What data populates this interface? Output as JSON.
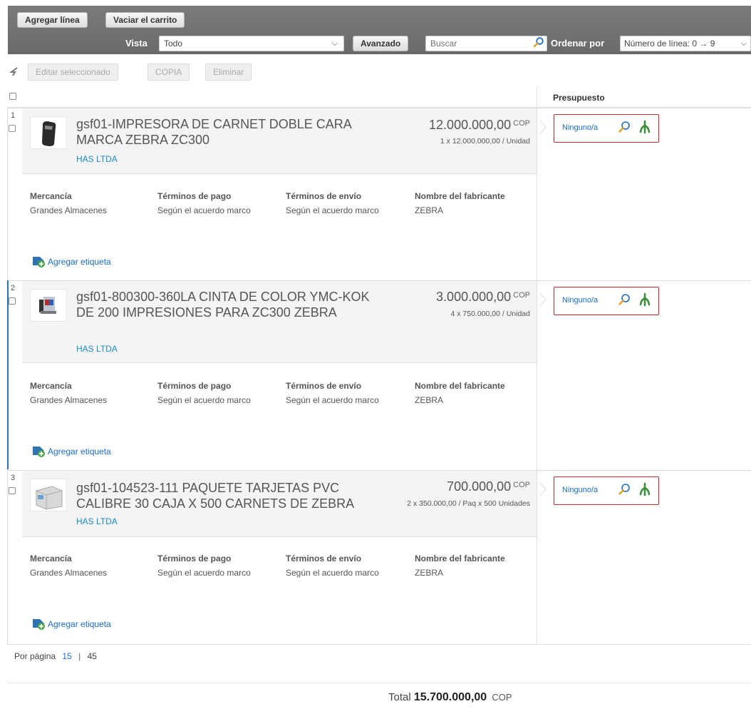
{
  "toolbar": {
    "add_line": "Agregar línea",
    "empty_cart": "Vaciar el carrito",
    "view_label": "Vista",
    "view_value": "Todo",
    "advanced": "Avanzado",
    "search_placeholder": "Buscar",
    "sort_label": "Ordenar por",
    "sort_value": "Número de línea: 0 → 9"
  },
  "actions": {
    "edit_selected": "Editar seleccionado",
    "copy": "COPIA",
    "delete": "Eliminar"
  },
  "grid": {
    "budget_header": "Presupuesto"
  },
  "attr_labels": {
    "commodity": "Mercancía",
    "payment_terms": "Términos de pago",
    "shipping_terms": "Términos de envío",
    "manufacturer": "Nombre del fabricante"
  },
  "items": [
    {
      "number": "1",
      "title": "gsf01-IMPRESORA DE CARNET DOBLE CARA MARCA ZEBRA ZC300",
      "supplier": "HAS LTDA",
      "price": "12.000.000,00",
      "currency": "COP",
      "unit_info": "1 x 12.000.000,00 / Unidad",
      "budget": "Ninguno/a",
      "commodity": "Grandes Almacenes",
      "payment_terms": "Según el acuerdo marco",
      "shipping_terms": "Según el acuerdo marco",
      "manufacturer": "ZEBRA",
      "add_tag": "Agregar etiqueta"
    },
    {
      "number": "2",
      "title": "gsf01-800300-360LA CINTA DE COLOR YMC-KOK DE 200 IMPRESIONES PARA ZC300 ZEBRA",
      "supplier": "HAS LTDA",
      "price": "3.000.000,00",
      "currency": "COP",
      "unit_info": "4 x 750.000,00 / Unidad",
      "budget": "Ninguno/a",
      "commodity": "Grandes Almacenes",
      "payment_terms": "Según el acuerdo marco",
      "shipping_terms": "Según el acuerdo marco",
      "manufacturer": "ZEBRA",
      "add_tag": "Agregar etiqueta"
    },
    {
      "number": "3",
      "title": "gsf01-104523-111 PAQUETE TARJETAS PVC CALIBRE 30 CAJA X 500 CARNETS DE ZEBRA",
      "supplier": "HAS LTDA",
      "price": "700.000,00",
      "currency": "COP",
      "unit_info": "2 x 350.000,00 / Paq x 500 Unidades",
      "budget": "Ninguno/a",
      "commodity": "Grandes Almacenes",
      "payment_terms": "Según el acuerdo marco",
      "shipping_terms": "Según el acuerdo marco",
      "manufacturer": "ZEBRA",
      "add_tag": "Agregar etiqueta"
    }
  ],
  "pagination": {
    "label": "Por página",
    "active": "15",
    "separator": "|",
    "other": "45"
  },
  "total": {
    "label": "Total",
    "value": "15.700.000,00",
    "currency": "COP"
  },
  "colors": {
    "toolbar_bg": "#707070",
    "link_blue": "#1a6ec6",
    "supplier_blue": "#1a8cc6",
    "budget_border": "#c62a2a"
  }
}
